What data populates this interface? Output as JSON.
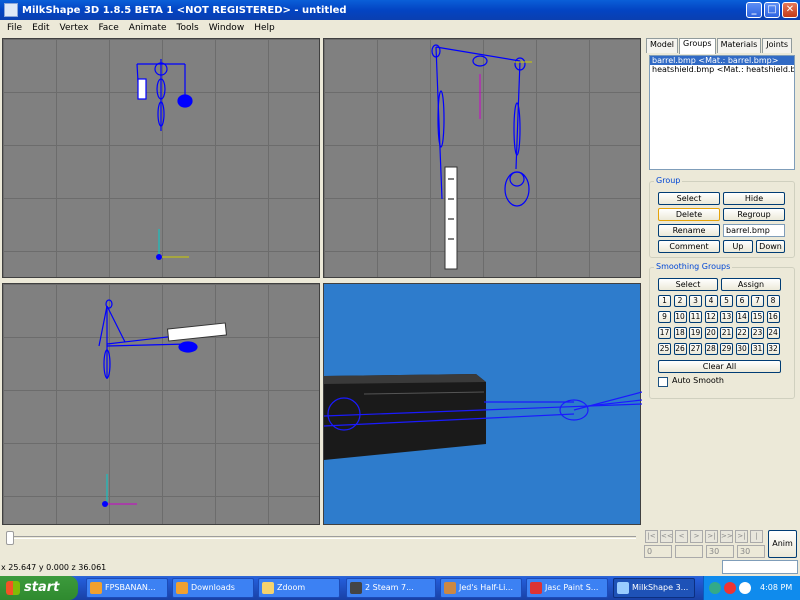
{
  "window": {
    "title": "MilkShape 3D 1.8.5 BETA 1 <NOT REGISTERED> - untitled",
    "minimize": "_",
    "maximize": "□",
    "close": "✕"
  },
  "menu": [
    "File",
    "Edit",
    "Vertex",
    "Face",
    "Animate",
    "Tools",
    "Window",
    "Help"
  ],
  "tabs": [
    "Model",
    "Groups",
    "Materials",
    "Joints"
  ],
  "active_tab": "Groups",
  "groups_list": [
    "barrel.bmp <Mat.: barrel.bmp>",
    "heatshield.bmp <Mat.: heatshield.bmp>"
  ],
  "group_section": {
    "title": "Group",
    "select": "Select",
    "hide": "Hide",
    "delete": "Delete",
    "regroup": "Regroup",
    "rename": "Rename",
    "name_value": "barrel.bmp",
    "comment": "Comment",
    "up": "Up",
    "down": "Down"
  },
  "smoothing": {
    "title": "Smoothing Groups",
    "select": "Select",
    "assign": "Assign",
    "numbers": [
      "1",
      "2",
      "3",
      "4",
      "5",
      "6",
      "7",
      "8",
      "9",
      "10",
      "11",
      "12",
      "13",
      "14",
      "15",
      "16",
      "17",
      "18",
      "19",
      "20",
      "21",
      "22",
      "23",
      "24",
      "25",
      "26",
      "27",
      "28",
      "29",
      "30",
      "31",
      "32"
    ],
    "clear_all": "Clear All",
    "auto_smooth": "Auto Smooth"
  },
  "timeline": {
    "frame_start": "0",
    "frame_end": "30",
    "frame_total": "30",
    "anim_button": "Anim"
  },
  "status": {
    "coords": "x 25.647 y 0.000 z 36.061"
  },
  "taskbar": {
    "start": "start",
    "items": [
      "FPSBANAN...",
      "Downloads",
      "Zdoom",
      "2 Steam 7...",
      "Jed's Half-Li...",
      "Jasc Paint S...",
      "MilkShape 3..."
    ],
    "clock": "4:08 PM"
  },
  "colors": {
    "wire": "#0000ff",
    "viewport_bg": "#808080",
    "viewport_3d_bg": "#2e7ccc"
  }
}
